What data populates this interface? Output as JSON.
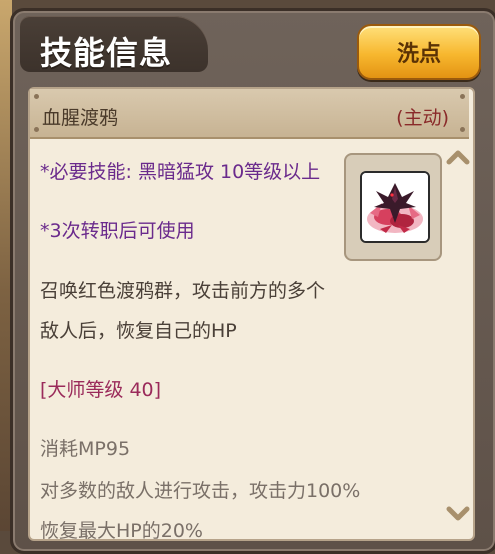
{
  "window": {
    "title": "技能信息",
    "wash_button": "洗点"
  },
  "skill": {
    "name": "血腥渡鸦",
    "type": "(主动)"
  },
  "description": {
    "requirement": "*必要技能: 黑暗猛攻 10等级以上",
    "job_note": "*3次转职后可使用",
    "summary_line1": "召唤红色渡鸦群，攻击前方的多个",
    "summary_line2": "敌人后，恢复自己的HP",
    "master_level": "[大师等级 40]",
    "mp_cost": "消耗MP95",
    "effect_line1": "对多数的敌人进行攻击，攻击力100%",
    "effect_line2_partial": "恢复最大HP的20%"
  },
  "icons": {
    "skill_icon": "crimson-raven-icon",
    "scroll_up": "chevron-up-icon",
    "scroll_down": "chevron-down-icon"
  },
  "colors": {
    "accent_button": "#f7b72e",
    "requirement_text": "#6a2a8c",
    "master_level_text": "#9a2a5a",
    "active_label": "#8a2a2a"
  }
}
